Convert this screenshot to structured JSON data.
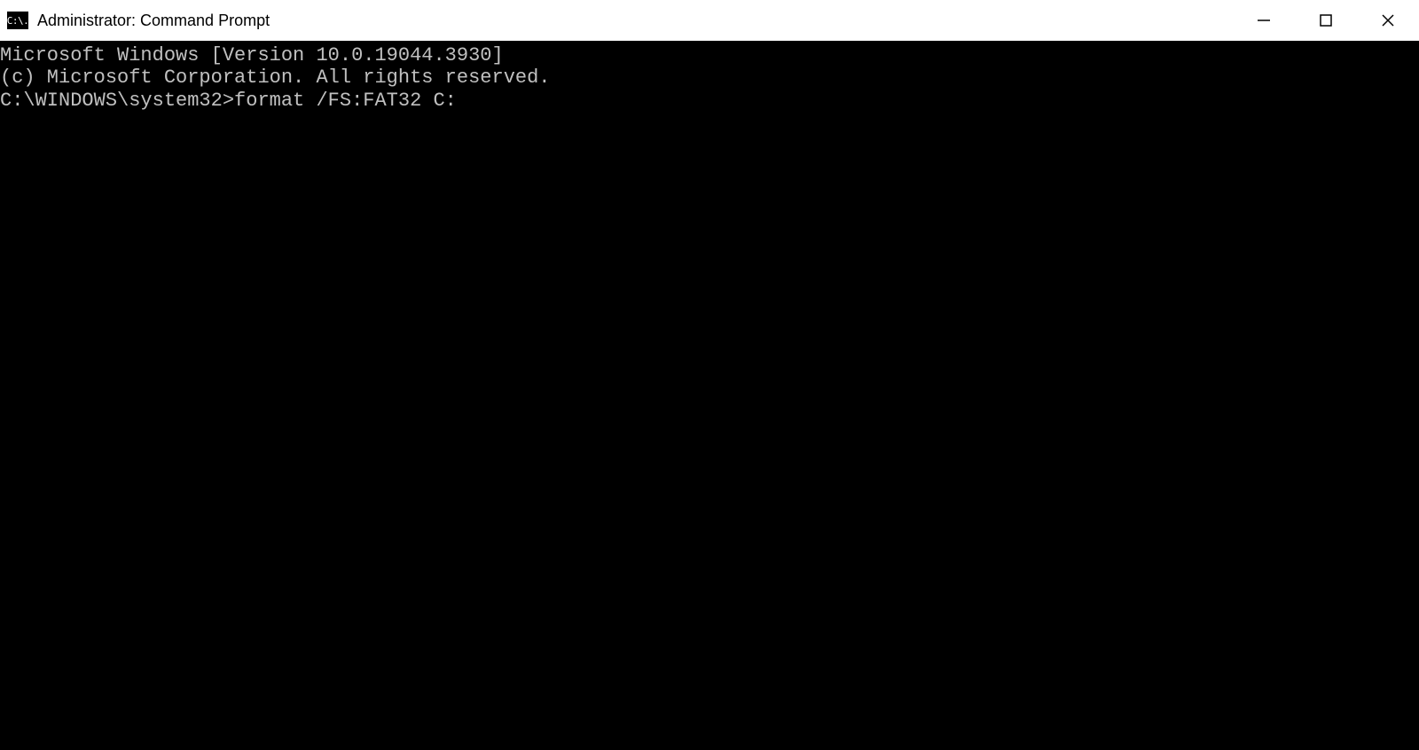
{
  "titlebar": {
    "icon_label": "C:\\.",
    "title": "Administrator: Command Prompt"
  },
  "terminal": {
    "line1": "Microsoft Windows [Version 10.0.19044.3930]",
    "line2": "(c) Microsoft Corporation. All rights reserved.",
    "blank": "",
    "prompt": "C:\\WINDOWS\\system32>",
    "command": "format /FS:FAT32 C:"
  }
}
